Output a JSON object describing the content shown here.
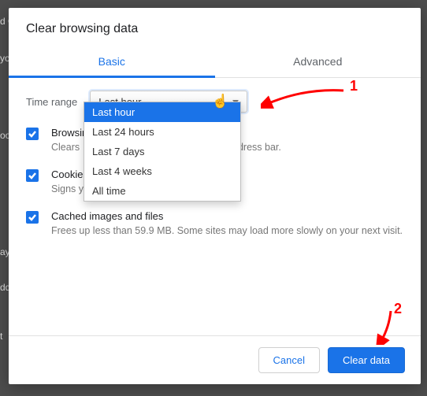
{
  "header": {
    "title": "Clear browsing data"
  },
  "tabs": {
    "basic": "Basic",
    "advanced": "Advanced"
  },
  "time": {
    "label": "Time range",
    "selected": "Last hour",
    "options": [
      "Last hour",
      "Last 24 hours",
      "Last 7 days",
      "Last 4 weeks",
      "All time"
    ]
  },
  "items": {
    "history": {
      "title": "Browsing history",
      "desc_prefix": "Clears ",
      "desc_suffix": " address bar."
    },
    "cookies": {
      "title": "Cookies and other site data",
      "desc": "Signs you out of most sites."
    },
    "cache": {
      "title": "Cached images and files",
      "desc": "Frees up less than 59.9 MB. Some sites may load more slowly on your next visit."
    }
  },
  "footer": {
    "cancel": "Cancel",
    "clear": "Clear data"
  },
  "annotations": {
    "one": "1",
    "two": "2"
  },
  "bg_hints": {
    "a": "d G",
    "b": "yo",
    "c": "oo",
    "d": "ayo",
    "e": "dd",
    "f": "t"
  }
}
